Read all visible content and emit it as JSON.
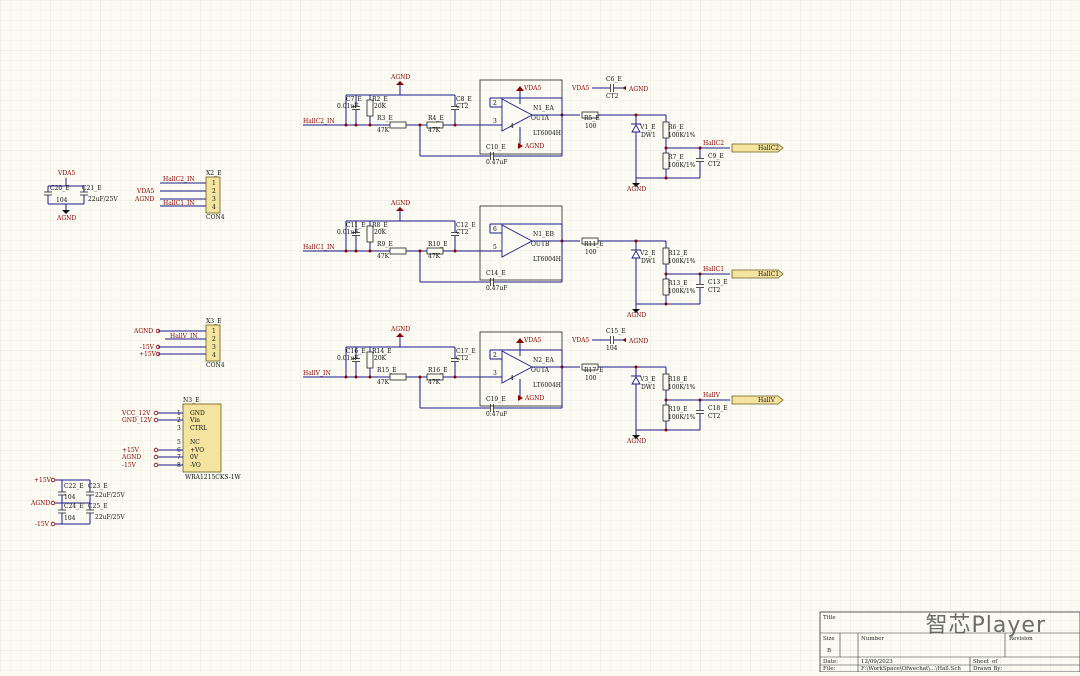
{
  "sheet": {
    "title_label": "Title",
    "size_label": "Size",
    "size_value": "B",
    "number_label": "Number",
    "revision_label": "Revision",
    "date_label": "Date:",
    "date_value": "12/09/2023",
    "file_label": "File:",
    "file_value": "F:\\WorkSpace\\Ofwechat\\...\\Hall.Sch",
    "sheet_label": "Sheet",
    "of_label": "of",
    "drawn_by_label": "Drawn By:"
  },
  "watermark": "智芯Player",
  "channels": [
    {
      "input_port": "HallC2_IN",
      "output_port": "HallC2",
      "output_net": "HallC2",
      "opamp_ref": "N1_EA",
      "opamp_part": "LT6004H",
      "opamp_pins": [
        "2",
        "3",
        "4"
      ],
      "out_pin_label": "OUTA",
      "supply_net": "VDA5",
      "show_vsupply": true,
      "cap_ref": "C7_E",
      "cap_val": "0.01uF",
      "r_in_ref": "R2_E",
      "r_in_val": "20K",
      "r3_ref": "R3_E",
      "r3_val": "47K",
      "r4_ref": "R4_E",
      "r4_val": "47K",
      "cfb_ref": "C8_E",
      "cfb_val": "CT2",
      "cbot_ref": "C10_E",
      "cbot_val": "0.47uF",
      "rs_ref": "R5_E",
      "rs_val": "100",
      "diode_ref": "V1_E",
      "diode_val": "DW1",
      "rt_ref": "R6_E",
      "rt_val": "100K/1%",
      "rb_ref": "R7_E",
      "rb_val": "100K/1%",
      "co_ref": "C9_E",
      "co_val": "CT2",
      "dec_ref": "C6_E",
      "dec_val": "CT2",
      "show_dec": true,
      "agnd": "AGND"
    },
    {
      "input_port": "HallC1_IN",
      "output_port": "HallC1",
      "output_net": "HallC1",
      "opamp_ref": "N1_EB",
      "opamp_part": "LT6004H",
      "opamp_pins": [
        "6",
        "5",
        ""
      ],
      "out_pin_label": "OUTB",
      "supply_net": "",
      "show_vsupply": false,
      "cap_ref": "C11_E",
      "cap_val": "0.01uF",
      "r_in_ref": "R8_E",
      "r_in_val": "20K",
      "r3_ref": "R9_E",
      "r3_val": "47K",
      "r4_ref": "R10_E",
      "r4_val": "47K",
      "cfb_ref": "C12_E",
      "cfb_val": "CT2",
      "cbot_ref": "C14_E",
      "cbot_val": "0.47uF",
      "rs_ref": "R11_E",
      "rs_val": "100",
      "diode_ref": "V2_E",
      "diode_val": "DW1",
      "rt_ref": "R12_E",
      "rt_val": "100K/1%",
      "rb_ref": "R13_E",
      "rb_val": "100K/1%",
      "co_ref": "C13_E",
      "co_val": "CT2",
      "dec_ref": "",
      "dec_val": "",
      "show_dec": false,
      "agnd": "AGND"
    },
    {
      "input_port": "HallV_IN",
      "output_port": "HallV",
      "output_net": "HallV",
      "opamp_ref": "N2_EA",
      "opamp_part": "LT6004H",
      "opamp_pins": [
        "2",
        "3",
        "4"
      ],
      "out_pin_label": "OUTA",
      "supply_net": "VDA5",
      "show_vsupply": true,
      "cap_ref": "C16_E",
      "cap_val": "0.01uF",
      "r_in_ref": "R14_E",
      "r_in_val": "20K",
      "r3_ref": "R15_E",
      "r3_val": "47K",
      "r4_ref": "R16_E",
      "r4_val": "47K",
      "cfb_ref": "C17_E",
      "cfb_val": "CT2",
      "cbot_ref": "C19_E",
      "cbot_val": "0.47uF",
      "rs_ref": "R17_E",
      "rs_val": "100",
      "diode_ref": "V3_E",
      "diode_val": "DW1",
      "rt_ref": "R18_E",
      "rt_val": "100K/1%",
      "rb_ref": "R19_E",
      "rb_val": "100K/1%",
      "co_ref": "C18_E",
      "co_val": "CT2",
      "dec_ref": "C15_E",
      "dec_val": "104",
      "show_dec": true,
      "agnd": "AGND"
    }
  ],
  "decoupling_top": {
    "supply": "VDA5",
    "c1_ref": "C20_E",
    "c1_val": "104",
    "c2_ref": "C21_E",
    "c2_val": "22uF/25V",
    "gnd": "AGND"
  },
  "connector_x2": {
    "ref": "X2_E",
    "part": "CON4",
    "pins": [
      "1",
      "2",
      "3",
      "4"
    ],
    "nets": [
      "HallC2_IN",
      "VDA5",
      "AGND",
      "HallC1_IN"
    ]
  },
  "connector_x3": {
    "ref": "X3_E",
    "part": "CON4",
    "pins": [
      "1",
      "2",
      "3",
      "4"
    ],
    "nets": [
      "AGND",
      "HallV_IN",
      "-15V",
      "+15V"
    ]
  },
  "dcdc": {
    "ref": "N3_E",
    "part": "WRA1215CKS-1W",
    "pin_numbers": [
      "1",
      "2",
      "3",
      "5",
      "6",
      "7",
      "8"
    ],
    "pin_names": [
      "GND",
      "Vin",
      "CTRL",
      "NC",
      "+VO",
      "0V",
      "-VO"
    ],
    "nets": [
      "VCC_12V",
      "GND_12V",
      "",
      "",
      "+15V",
      "AGND",
      "-15V"
    ]
  },
  "decoupling_bottom": {
    "pos": "+15V",
    "neg": "-15V",
    "gnd": "AGND",
    "c22_ref": "C22_E",
    "c22_val": "104",
    "c23_ref": "C23_E",
    "c23_val": "22uF/25V",
    "c24_ref": "C24_E",
    "c24_val": "104",
    "c25_ref": "C25_E",
    "c25_val": "22uF/25V"
  }
}
